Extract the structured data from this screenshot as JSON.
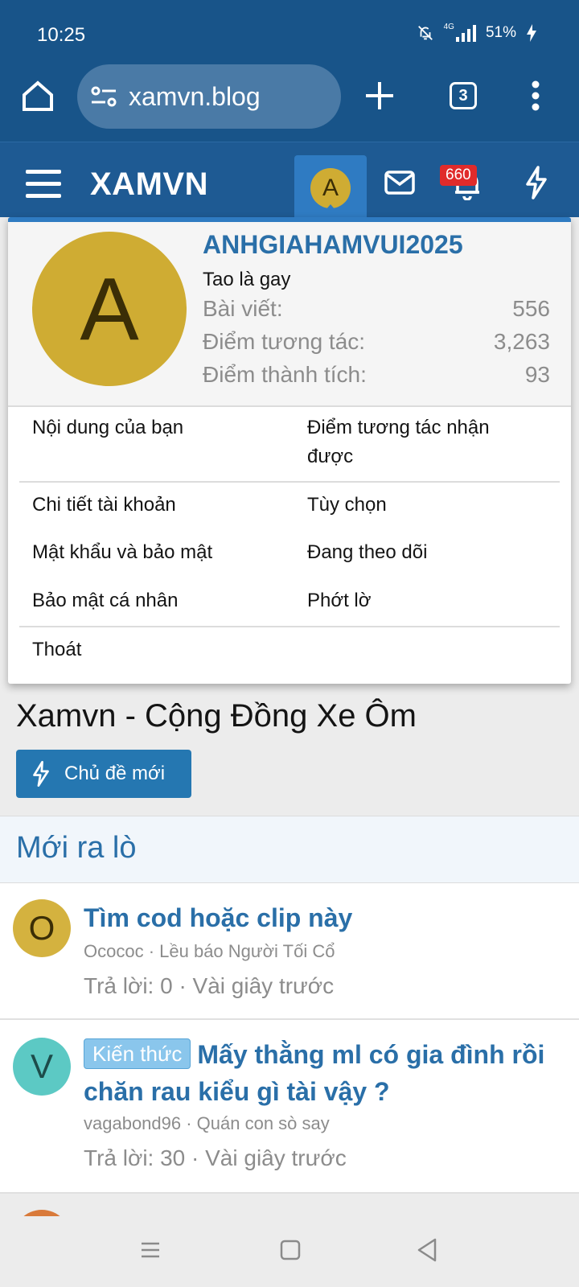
{
  "status_bar": {
    "time": "10:25",
    "network": "4G",
    "battery": "51%"
  },
  "browser": {
    "url": "xamvn.blog",
    "tab_count": "3",
    "icons": [
      "home-icon",
      "site-settings-icon",
      "new-tab-icon",
      "tabs-icon",
      "more-icon"
    ]
  },
  "site_nav": {
    "logo": "XAMVN",
    "avatar_letter": "A",
    "notification_count": "660",
    "icons": [
      "menu-icon",
      "inbox-icon",
      "bell-icon",
      "whats-new-icon"
    ]
  },
  "account_popup": {
    "avatar_letter": "A",
    "username": "ANHGIAHAMVUI2025",
    "user_title": "Tao là gay",
    "stats": [
      {
        "label": "Bài viết:",
        "value": "556"
      },
      {
        "label": "Điểm tương tác:",
        "value": "3,263"
      },
      {
        "label": "Điểm thành tích:",
        "value": "93"
      }
    ],
    "menu": {
      "your_content": "Nội dung của bạn",
      "reactions_received_1": "Điểm tương tác nhận",
      "reactions_received_2": "được",
      "account_details": "Chi tiết tài khoản",
      "preferences": "Tùy chọn",
      "password_security": "Mật khẩu và bảo mật",
      "following": "Đang theo dõi",
      "privacy": "Bảo mật cá nhân",
      "ignoring": "Phớt lờ",
      "logout": "Thoát"
    }
  },
  "main": {
    "title": "Xamvn - Cộng Đồng Xe Ôm",
    "new_thread_button": "Chủ đề mới",
    "section_title": "Mới ra lò",
    "threads": [
      {
        "avatar": "O",
        "avatar_color": "#d4b23f",
        "title": "Tìm cod hoặc clip này",
        "meta": "Ocococ · Lều báo Người Tối Cổ",
        "stats": "Trả lời: 0 · Vài giây trước"
      },
      {
        "avatar": "V",
        "avatar_color": "#5cc9c4",
        "tag": "Kiến thức",
        "title": "Mấy thằng ml có gia đình rồi chăn rau kiểu gì tài vậy ?",
        "meta": "vagabond96 · Quán con sò say",
        "stats": "Trả lời: 30 · Vài giây trước"
      }
    ]
  },
  "colors": {
    "header": "#185489",
    "accent": "#2a6fa8",
    "avatar_gold": "#cfac33",
    "badge_red": "#e02b2b"
  }
}
